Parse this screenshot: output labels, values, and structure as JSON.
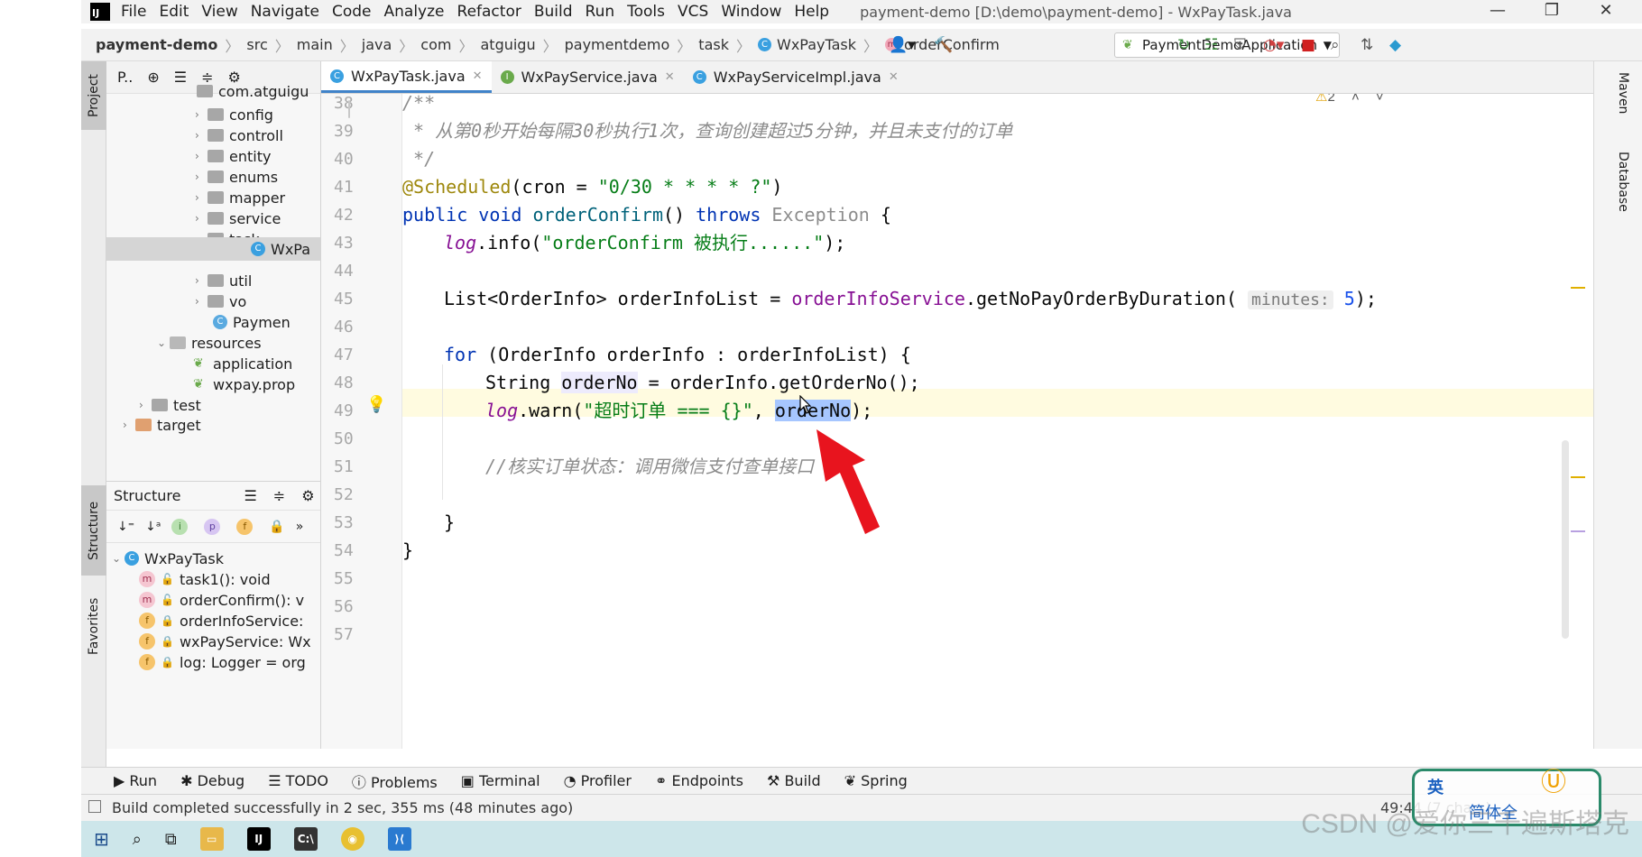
{
  "menu": {
    "items": [
      "File",
      "Edit",
      "View",
      "Navigate",
      "Code",
      "Analyze",
      "Refactor",
      "Build",
      "Run",
      "Tools",
      "VCS",
      "Window",
      "Help"
    ],
    "window_title": "payment-demo [D:\\demo\\payment-demo] - WxPayTask.java"
  },
  "breadcrumbs": [
    "payment-demo",
    "src",
    "main",
    "java",
    "com",
    "atguigu",
    "paymentdemo",
    "task",
    "WxPayTask",
    "orderConfirm"
  ],
  "run_config": "PaymentDemoApplication",
  "left_tabs": {
    "project": "Project",
    "structure": "Structure",
    "favorites": "Favorites"
  },
  "right_tabs": {
    "maven": "Maven",
    "database": "Database"
  },
  "project": {
    "toolbar_label": "P..",
    "tree": [
      {
        "label": "com.atguigu",
        "level": 2
      },
      {
        "label": "config",
        "level": 3
      },
      {
        "label": "controll",
        "level": 3
      },
      {
        "label": "entity",
        "level": 3
      },
      {
        "label": "enums",
        "level": 3
      },
      {
        "label": "mapper",
        "level": 3
      },
      {
        "label": "service",
        "level": 3
      },
      {
        "label": "task",
        "level": 3
      },
      {
        "label": "WxPa",
        "level": 4
      },
      {
        "label": "util",
        "level": 3
      },
      {
        "label": "vo",
        "level": 3
      },
      {
        "label": "Paymen",
        "level": 3
      },
      {
        "label": "resources",
        "level": 2
      },
      {
        "label": "application",
        "level": 3
      },
      {
        "label": "wxpay.prop",
        "level": 3
      },
      {
        "label": "test",
        "level": 1
      },
      {
        "label": "target",
        "level": 1
      }
    ]
  },
  "structure": {
    "title": "Structure",
    "root": "WxPayTask",
    "items": [
      {
        "badge": "m",
        "label": "task1(): void"
      },
      {
        "badge": "m",
        "label": "orderConfirm(): v"
      },
      {
        "badge": "f",
        "label": "orderInfoService:"
      },
      {
        "badge": "f",
        "label": "wxPayService: Wx"
      },
      {
        "badge": "f",
        "label": "log: Logger = org"
      }
    ]
  },
  "tabs": [
    {
      "label": "WxPayTask.java",
      "icon": "class-icon",
      "active": true
    },
    {
      "label": "WxPayService.java",
      "icon": "interface-icon",
      "active": false
    },
    {
      "label": "WxPayServiceImpl.java",
      "icon": "class-icon",
      "active": false
    }
  ],
  "editor": {
    "line_numbers": [
      "38",
      "39",
      "40",
      "41",
      "42",
      "43",
      "44",
      "45",
      "46",
      "47",
      "48",
      "49",
      "50",
      "51",
      "52",
      "53",
      "54",
      "55",
      "56",
      "57"
    ],
    "inspection_count": "2",
    "lines": {
      "l38": "/**",
      "l39": " * 从第0秒开始每隔30秒执行1次，查询创建超过5分钟，并且未支付的订单",
      "l40": " */",
      "l41_ann": "@Scheduled",
      "l41_a": "(cron = ",
      "l41_str": "\"0/30 * * * * ?\"",
      "l41_b": ")",
      "l42_kw1": "public void ",
      "l42_mth": "orderConfirm",
      "l42_a": "() ",
      "l42_kw2": "throws ",
      "l42_exc": "Exception",
      "l42_b": " {",
      "l43_log": "log",
      "l43_a": ".info(",
      "l43_str": "\"orderConfirm 被执行......\"",
      "l43_b": ");",
      "l45_a": "List<OrderInfo> orderInfoList = ",
      "l45_fld": "orderInfoService",
      "l45_b": ".getNoPayOrderByDuration( ",
      "l45_hint": "minutes:",
      "l45_num": " 5",
      "l45_c": ");",
      "l47_kw": "for ",
      "l47_a": "(OrderInfo orderInfo : orderInfoList) {",
      "l48_a": "String ",
      "l48_var": "orderNo",
      "l48_b": " = orderInfo.getOrderNo();",
      "l49_log": "log",
      "l49_a": ".warn(",
      "l49_str": "\"超时订单 === {}\"",
      "l49_b": ", ",
      "l49_sel": "orderNo",
      "l49_c": ");",
      "l51": "//核实订单状态：调用微信支付查单接口",
      "l53": "}",
      "l54": "}",
      "l56": "}"
    }
  },
  "bottom_tools": [
    "Run",
    "Debug",
    "TODO",
    "Problems",
    "Terminal",
    "Profiler",
    "Endpoints",
    "Build",
    "Spring"
  ],
  "status": {
    "message": "Build completed successfully in 2 sec, 355 ms (48 minutes ago)",
    "position": "49:44 (7 chars)"
  },
  "watermark": "CSDN @爱你三千遍斯塔克",
  "ime": {
    "lang": "英",
    "label": "简体全"
  },
  "colors": {
    "accent": "#4083c9",
    "arrow": "#e8141e",
    "selection": "#a6c6ff"
  }
}
